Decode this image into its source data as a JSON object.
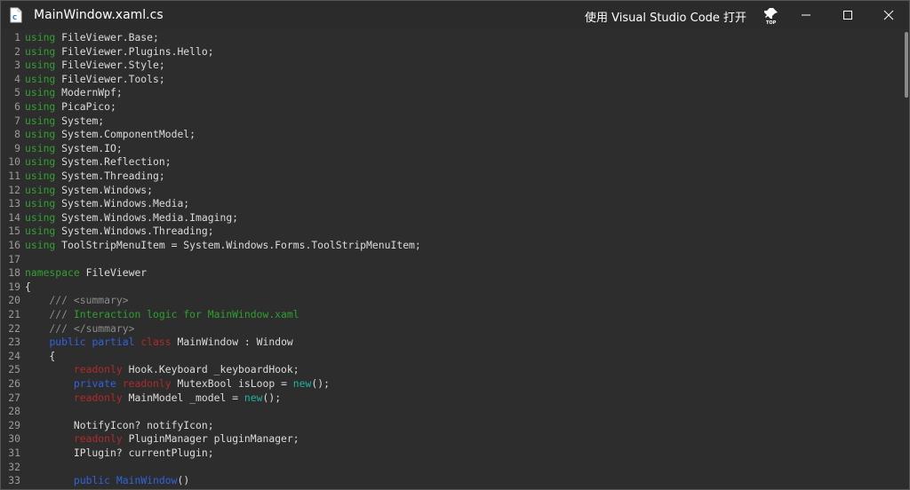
{
  "window": {
    "title": "MainWindow.xaml.cs",
    "open_with_label": "使用 Visual Studio Code 打开",
    "pin_icon": "top-pin-icon",
    "file_icon": "csharp-file-icon",
    "controls": [
      "minimize-icon",
      "maximize-icon",
      "close-icon"
    ]
  },
  "colors": {
    "background": "#2d2d2d",
    "keyword_using": "#32a032",
    "keyword_blue": "#2f63e0",
    "keyword_red": "#b02a2a",
    "keyword_teal": "#1fb39e",
    "comment": "#2f9f2f",
    "text": "#dcdcdc"
  },
  "editor": {
    "lines": [
      {
        "n": "1",
        "tokens": [
          {
            "t": "using",
            "c": "kw-using"
          },
          {
            "t": " FileViewer.Base;",
            "c": "plain"
          }
        ]
      },
      {
        "n": "2",
        "tokens": [
          {
            "t": "using",
            "c": "kw-using"
          },
          {
            "t": " FileViewer.Plugins.Hello;",
            "c": "plain"
          }
        ]
      },
      {
        "n": "3",
        "tokens": [
          {
            "t": "using",
            "c": "kw-using"
          },
          {
            "t": " FileViewer.Style;",
            "c": "plain"
          }
        ]
      },
      {
        "n": "4",
        "tokens": [
          {
            "t": "using",
            "c": "kw-using"
          },
          {
            "t": " FileViewer.Tools;",
            "c": "plain"
          }
        ]
      },
      {
        "n": "5",
        "tokens": [
          {
            "t": "using",
            "c": "kw-using"
          },
          {
            "t": " ModernWpf;",
            "c": "plain"
          }
        ]
      },
      {
        "n": "6",
        "tokens": [
          {
            "t": "using",
            "c": "kw-using"
          },
          {
            "t": " PicaPico;",
            "c": "plain"
          }
        ]
      },
      {
        "n": "7",
        "tokens": [
          {
            "t": "using",
            "c": "kw-using"
          },
          {
            "t": " System;",
            "c": "plain"
          }
        ]
      },
      {
        "n": "8",
        "tokens": [
          {
            "t": "using",
            "c": "kw-using"
          },
          {
            "t": " System.ComponentModel;",
            "c": "plain"
          }
        ]
      },
      {
        "n": "9",
        "tokens": [
          {
            "t": "using",
            "c": "kw-using"
          },
          {
            "t": " System.IO;",
            "c": "plain"
          }
        ]
      },
      {
        "n": "10",
        "tokens": [
          {
            "t": "using",
            "c": "kw-using"
          },
          {
            "t": " System.Reflection;",
            "c": "plain"
          }
        ]
      },
      {
        "n": "11",
        "tokens": [
          {
            "t": "using",
            "c": "kw-using"
          },
          {
            "t": " System.Threading;",
            "c": "plain"
          }
        ]
      },
      {
        "n": "12",
        "tokens": [
          {
            "t": "using",
            "c": "kw-using"
          },
          {
            "t": " System.Windows;",
            "c": "plain"
          }
        ]
      },
      {
        "n": "13",
        "tokens": [
          {
            "t": "using",
            "c": "kw-using"
          },
          {
            "t": " System.Windows.Media;",
            "c": "plain"
          }
        ]
      },
      {
        "n": "14",
        "tokens": [
          {
            "t": "using",
            "c": "kw-using"
          },
          {
            "t": " System.Windows.Media.Imaging;",
            "c": "plain"
          }
        ]
      },
      {
        "n": "15",
        "tokens": [
          {
            "t": "using",
            "c": "kw-using"
          },
          {
            "t": " System.Windows.Threading;",
            "c": "plain"
          }
        ]
      },
      {
        "n": "16",
        "tokens": [
          {
            "t": "using",
            "c": "kw-using"
          },
          {
            "t": " ToolStripMenuItem = System.Windows.Forms.ToolStripMenuItem;",
            "c": "plain"
          }
        ]
      },
      {
        "n": "17",
        "tokens": []
      },
      {
        "n": "18",
        "tokens": [
          {
            "t": "namespace",
            "c": "kw-using"
          },
          {
            "t": " FileViewer",
            "c": "plain"
          }
        ]
      },
      {
        "n": "19",
        "tokens": [
          {
            "t": "{",
            "c": "plain"
          }
        ]
      },
      {
        "n": "20",
        "tokens": [
          {
            "t": "    /// ",
            "c": "cm-gray"
          },
          {
            "t": "<summary>",
            "c": "cm-gray"
          }
        ]
      },
      {
        "n": "21",
        "tokens": [
          {
            "t": "    /// ",
            "c": "cm-gray"
          },
          {
            "t": "Interaction logic for MainWindow.xaml",
            "c": "cm-green"
          }
        ]
      },
      {
        "n": "22",
        "tokens": [
          {
            "t": "    /// ",
            "c": "cm-gray"
          },
          {
            "t": "</summary>",
            "c": "cm-gray"
          }
        ]
      },
      {
        "n": "23",
        "tokens": [
          {
            "t": "    ",
            "c": "plain"
          },
          {
            "t": "public",
            "c": "kw-blue"
          },
          {
            "t": " ",
            "c": "plain"
          },
          {
            "t": "partial",
            "c": "kw-blue"
          },
          {
            "t": " ",
            "c": "plain"
          },
          {
            "t": "class",
            "c": "kw-red"
          },
          {
            "t": " MainWindow : Window",
            "c": "plain"
          }
        ]
      },
      {
        "n": "24",
        "tokens": [
          {
            "t": "    {",
            "c": "plain"
          }
        ]
      },
      {
        "n": "25",
        "tokens": [
          {
            "t": "        ",
            "c": "plain"
          },
          {
            "t": "readonly",
            "c": "kw-red"
          },
          {
            "t": " Hook.Keyboard _keyboardHook;",
            "c": "plain"
          }
        ]
      },
      {
        "n": "26",
        "tokens": [
          {
            "t": "        ",
            "c": "plain"
          },
          {
            "t": "private",
            "c": "kw-blue"
          },
          {
            "t": " ",
            "c": "plain"
          },
          {
            "t": "readonly",
            "c": "kw-red"
          },
          {
            "t": " MutexBool isLoop = ",
            "c": "plain"
          },
          {
            "t": "new",
            "c": "kw-teal"
          },
          {
            "t": "();",
            "c": "plain"
          }
        ]
      },
      {
        "n": "27",
        "tokens": [
          {
            "t": "        ",
            "c": "plain"
          },
          {
            "t": "readonly",
            "c": "kw-red"
          },
          {
            "t": " MainModel _model = ",
            "c": "plain"
          },
          {
            "t": "new",
            "c": "kw-teal"
          },
          {
            "t": "();",
            "c": "plain"
          }
        ]
      },
      {
        "n": "28",
        "tokens": []
      },
      {
        "n": "29",
        "tokens": [
          {
            "t": "        NotifyIcon? notifyIcon;",
            "c": "plain"
          }
        ]
      },
      {
        "n": "30",
        "tokens": [
          {
            "t": "        ",
            "c": "plain"
          },
          {
            "t": "readonly",
            "c": "kw-red"
          },
          {
            "t": " PluginManager pluginManager;",
            "c": "plain"
          }
        ]
      },
      {
        "n": "31",
        "tokens": [
          {
            "t": "        IPlugin? currentPlugin;",
            "c": "plain"
          }
        ]
      },
      {
        "n": "32",
        "tokens": []
      },
      {
        "n": "33",
        "tokens": [
          {
            "t": "        ",
            "c": "plain"
          },
          {
            "t": "public",
            "c": "kw-blue"
          },
          {
            "t": " ",
            "c": "plain"
          },
          {
            "t": "MainWindow",
            "c": "kw-blue"
          },
          {
            "t": "()",
            "c": "plain"
          }
        ]
      }
    ]
  }
}
